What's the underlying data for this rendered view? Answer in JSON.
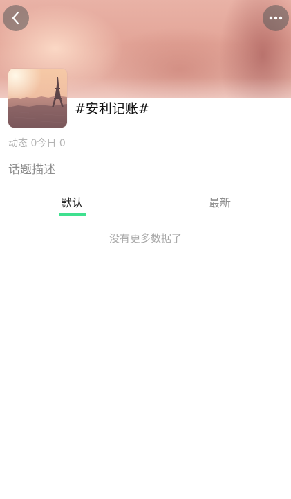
{
  "header": {
    "back_icon": "chevron-left-icon",
    "more_icon": "more-horizontal-icon"
  },
  "topic": {
    "title": "#安利记账#",
    "cover_icon": "eiffel-tower-cover-image",
    "stats": {
      "posts_label": "动态",
      "posts_count": "0",
      "today_label": "今日",
      "today_count": "0"
    },
    "description": "话题描述"
  },
  "tabs": [
    {
      "label": "默认",
      "active": true
    },
    {
      "label": "最新",
      "active": false
    }
  ],
  "colors": {
    "accent": "#3fe08f",
    "active_tab_text": "#222222",
    "inactive_tab_text": "#8f8f8f"
  },
  "empty_state": "没有更多数据了"
}
